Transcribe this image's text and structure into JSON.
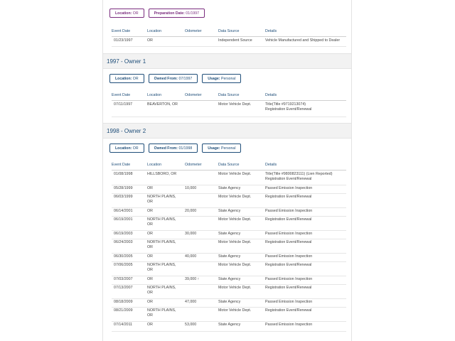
{
  "header_labels": {
    "event_date": "Event Date",
    "location": "Location",
    "odometer": "Odometer",
    "data_source": "Data Source",
    "details": "Details"
  },
  "section0": {
    "chips": [
      {
        "label": "Location:",
        "value": "OR"
      },
      {
        "label": "Preparation Date:",
        "value": "01/1997"
      }
    ],
    "rows": [
      {
        "date": "01/23/1997",
        "location": "OR",
        "odometer": "",
        "source": "Independent Source",
        "details": [
          "Vehicle Manufactured and Shipped to Dealer"
        ]
      }
    ]
  },
  "section1": {
    "title": "1997 - Owner   1",
    "chips": [
      {
        "label": "Location:",
        "value": "OR"
      },
      {
        "label": "Owned From:",
        "value": "07/1997"
      },
      {
        "label": "Usage:",
        "value": "Personal"
      }
    ],
    "rows": [
      {
        "date": "07/11/1997",
        "location": "BEAVERTON, OR",
        "odometer": "",
        "source": "Motor Vehicle Dept.",
        "details": [
          "Title(Title #9719213074)",
          "Registration Event/Renewal"
        ]
      }
    ]
  },
  "section2": {
    "title": "1998 - Owner   2",
    "chips": [
      {
        "label": "Location:",
        "value": "OR"
      },
      {
        "label": "Owned From:",
        "value": "01/1998"
      },
      {
        "label": "Usage:",
        "value": "Personal"
      }
    ],
    "rows": [
      {
        "date": "01/08/1998",
        "location": "HILLSBORO, OR",
        "odometer": "",
        "source": "Motor Vehicle Dept.",
        "details": [
          "Title(Title #9800823111) (Lien Reported)",
          "Registration Event/Renewal"
        ]
      },
      {
        "date": "05/28/1999",
        "location": "OR",
        "odometer": "10,000",
        "source": "State Agency",
        "details": [
          "Passed Emission Inspection"
        ]
      },
      {
        "date": "06/03/1999",
        "location": "NORTH PLAINS, OR",
        "odometer": "",
        "source": "Motor Vehicle Dept.",
        "details": [
          "Registration Event/Renewal"
        ]
      },
      {
        "date": "06/14/2001",
        "location": "OR",
        "odometer": "20,000",
        "source": "State Agency",
        "details": [
          "Passed Emission Inspection"
        ]
      },
      {
        "date": "06/19/2001",
        "location": "NORTH PLAINS, OR",
        "odometer": "",
        "source": "Motor Vehicle Dept.",
        "details": [
          "Registration Event/Renewal"
        ]
      },
      {
        "date": "06/19/2003",
        "location": "OR",
        "odometer": "30,000",
        "source": "State Agency",
        "details": [
          "Passed Emission Inspection"
        ]
      },
      {
        "date": "06/24/2003",
        "location": "NORTH PLAINS, OR",
        "odometer": "",
        "source": "Motor Vehicle Dept.",
        "details": [
          "Registration Event/Renewal"
        ]
      },
      {
        "date": "06/30/2005",
        "location": "OR",
        "odometer": "40,000",
        "source": "State Agency",
        "details": [
          "Passed Emission Inspection"
        ]
      },
      {
        "date": "07/06/2005",
        "location": "NORTH PLAINS, OR",
        "odometer": "",
        "source": "Motor Vehicle Dept.",
        "details": [
          "Registration Event/Renewal"
        ]
      },
      {
        "date": "07/03/2007",
        "location": "OR",
        "odometer": "39,000 ↑",
        "source": "State Agency",
        "details": [
          "Passed Emission Inspection"
        ]
      },
      {
        "date": "07/13/2007",
        "location": "NORTH PLAINS, OR",
        "odometer": "",
        "source": "Motor Vehicle Dept.",
        "details": [
          "Registration Event/Renewal"
        ]
      },
      {
        "date": "08/18/2009",
        "location": "OR",
        "odometer": "47,000",
        "source": "State Agency",
        "details": [
          "Passed Emission Inspection"
        ]
      },
      {
        "date": "08/21/2009",
        "location": "NORTH PLAINS, OR",
        "odometer": "",
        "source": "Motor Vehicle Dept.",
        "details": [
          "Registration Event/Renewal"
        ]
      },
      {
        "date": "07/14/2011",
        "location": "OR",
        "odometer": "53,000",
        "source": "State Agency",
        "details": [
          "Passed Emission Inspection"
        ]
      }
    ]
  }
}
